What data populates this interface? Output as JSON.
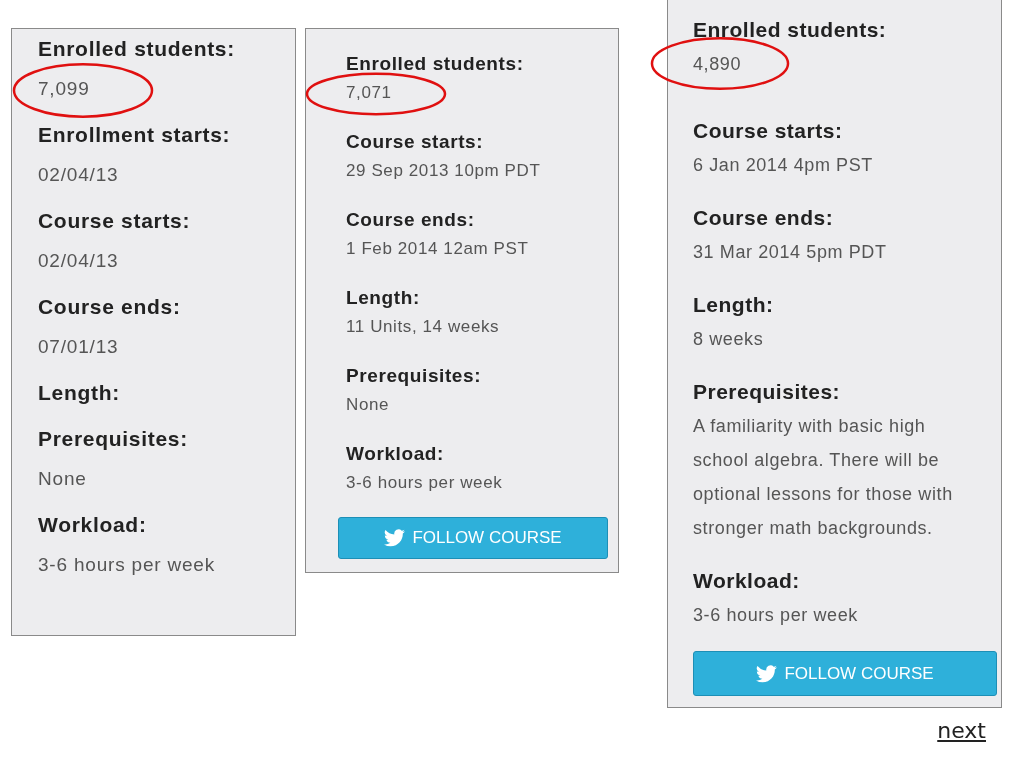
{
  "panels": [
    {
      "circled": true,
      "fields": [
        {
          "label": "Enrolled students:",
          "value": "7,099"
        },
        {
          "label": "Enrollment starts:",
          "value": "02/04/13"
        },
        {
          "label": "Course starts:",
          "value": "02/04/13"
        },
        {
          "label": "Course ends:",
          "value": "07/01/13"
        },
        {
          "label": "Length:"
        },
        {
          "label": "Prerequisites:",
          "value": "None"
        },
        {
          "label": "Workload:",
          "value": "3-6 hours per week"
        }
      ]
    },
    {
      "circled": true,
      "fields": [
        {
          "label": "Enrolled students:",
          "value": "7,071"
        },
        {
          "label": "Course starts:",
          "value": "29 Sep 2013 10pm PDT"
        },
        {
          "label": "Course ends:",
          "value": "1 Feb 2014 12am PST"
        },
        {
          "label": "Length:",
          "value": "11 Units, 14 weeks"
        },
        {
          "label": "Prerequisites:",
          "value": "None"
        },
        {
          "label": "Workload:",
          "value": "3-6 hours per week"
        }
      ],
      "button": {
        "label": "FOLLOW COURSE"
      }
    },
    {
      "circled": true,
      "fields": [
        {
          "label": "Enrolled students:",
          "value": "4,890"
        },
        {
          "label": "Course starts:",
          "value": "6 Jan 2014 4pm PST"
        },
        {
          "label": "Course ends:",
          "value": "31 Mar 2014 5pm PDT"
        },
        {
          "label": "Length:",
          "value": "8 weeks"
        },
        {
          "label": "Prerequisites:",
          "value": "A familiarity with basic high school algebra. There will be optional lessons for those with stronger math backgrounds."
        },
        {
          "label": "Workload:",
          "value": "3-6 hours per week"
        }
      ],
      "button": {
        "label": "FOLLOW COURSE"
      }
    }
  ],
  "next_link": "next"
}
